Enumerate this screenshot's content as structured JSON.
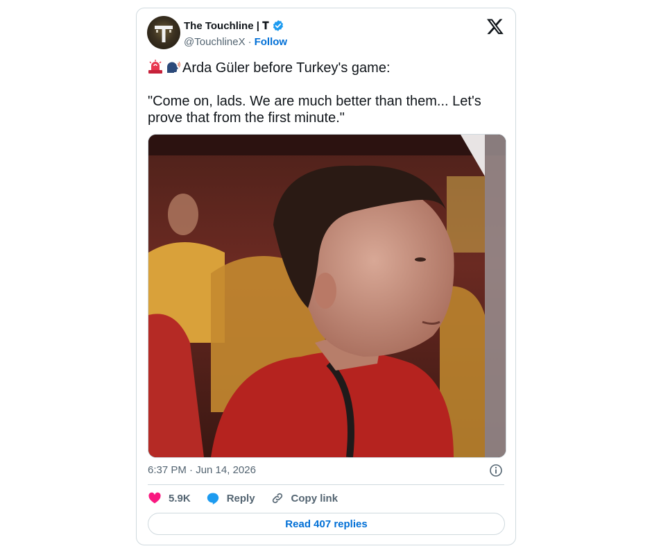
{
  "tweet": {
    "author": {
      "display_name": "The Touchline | 𝐓",
      "handle": "@TouchlineX",
      "separator": "·",
      "follow_label": "Follow",
      "verified": true,
      "avatar_icon": "touchline-t-logo"
    },
    "text_line1": "Arda Güler before Turkey's game:",
    "text_quote": "\"Come on, lads. We are much better than them... Let's prove that from the first minute.\"",
    "emojis": [
      "rotating-light-icon",
      "speaking-head-icon"
    ],
    "media": {
      "type": "video",
      "description_icon": "video-thumbnail"
    },
    "timestamp": "6:37 PM · Jun 14, 2026",
    "actions": {
      "like_count": "5.9K",
      "reply_label": "Reply",
      "copy_link_label": "Copy link"
    },
    "read_replies_label": "Read 407 replies"
  },
  "colors": {
    "accent": "#006fd6",
    "like": "#f91880",
    "reply": "#1d9bf0",
    "muted": "#536471",
    "border": "#cfd9de"
  }
}
